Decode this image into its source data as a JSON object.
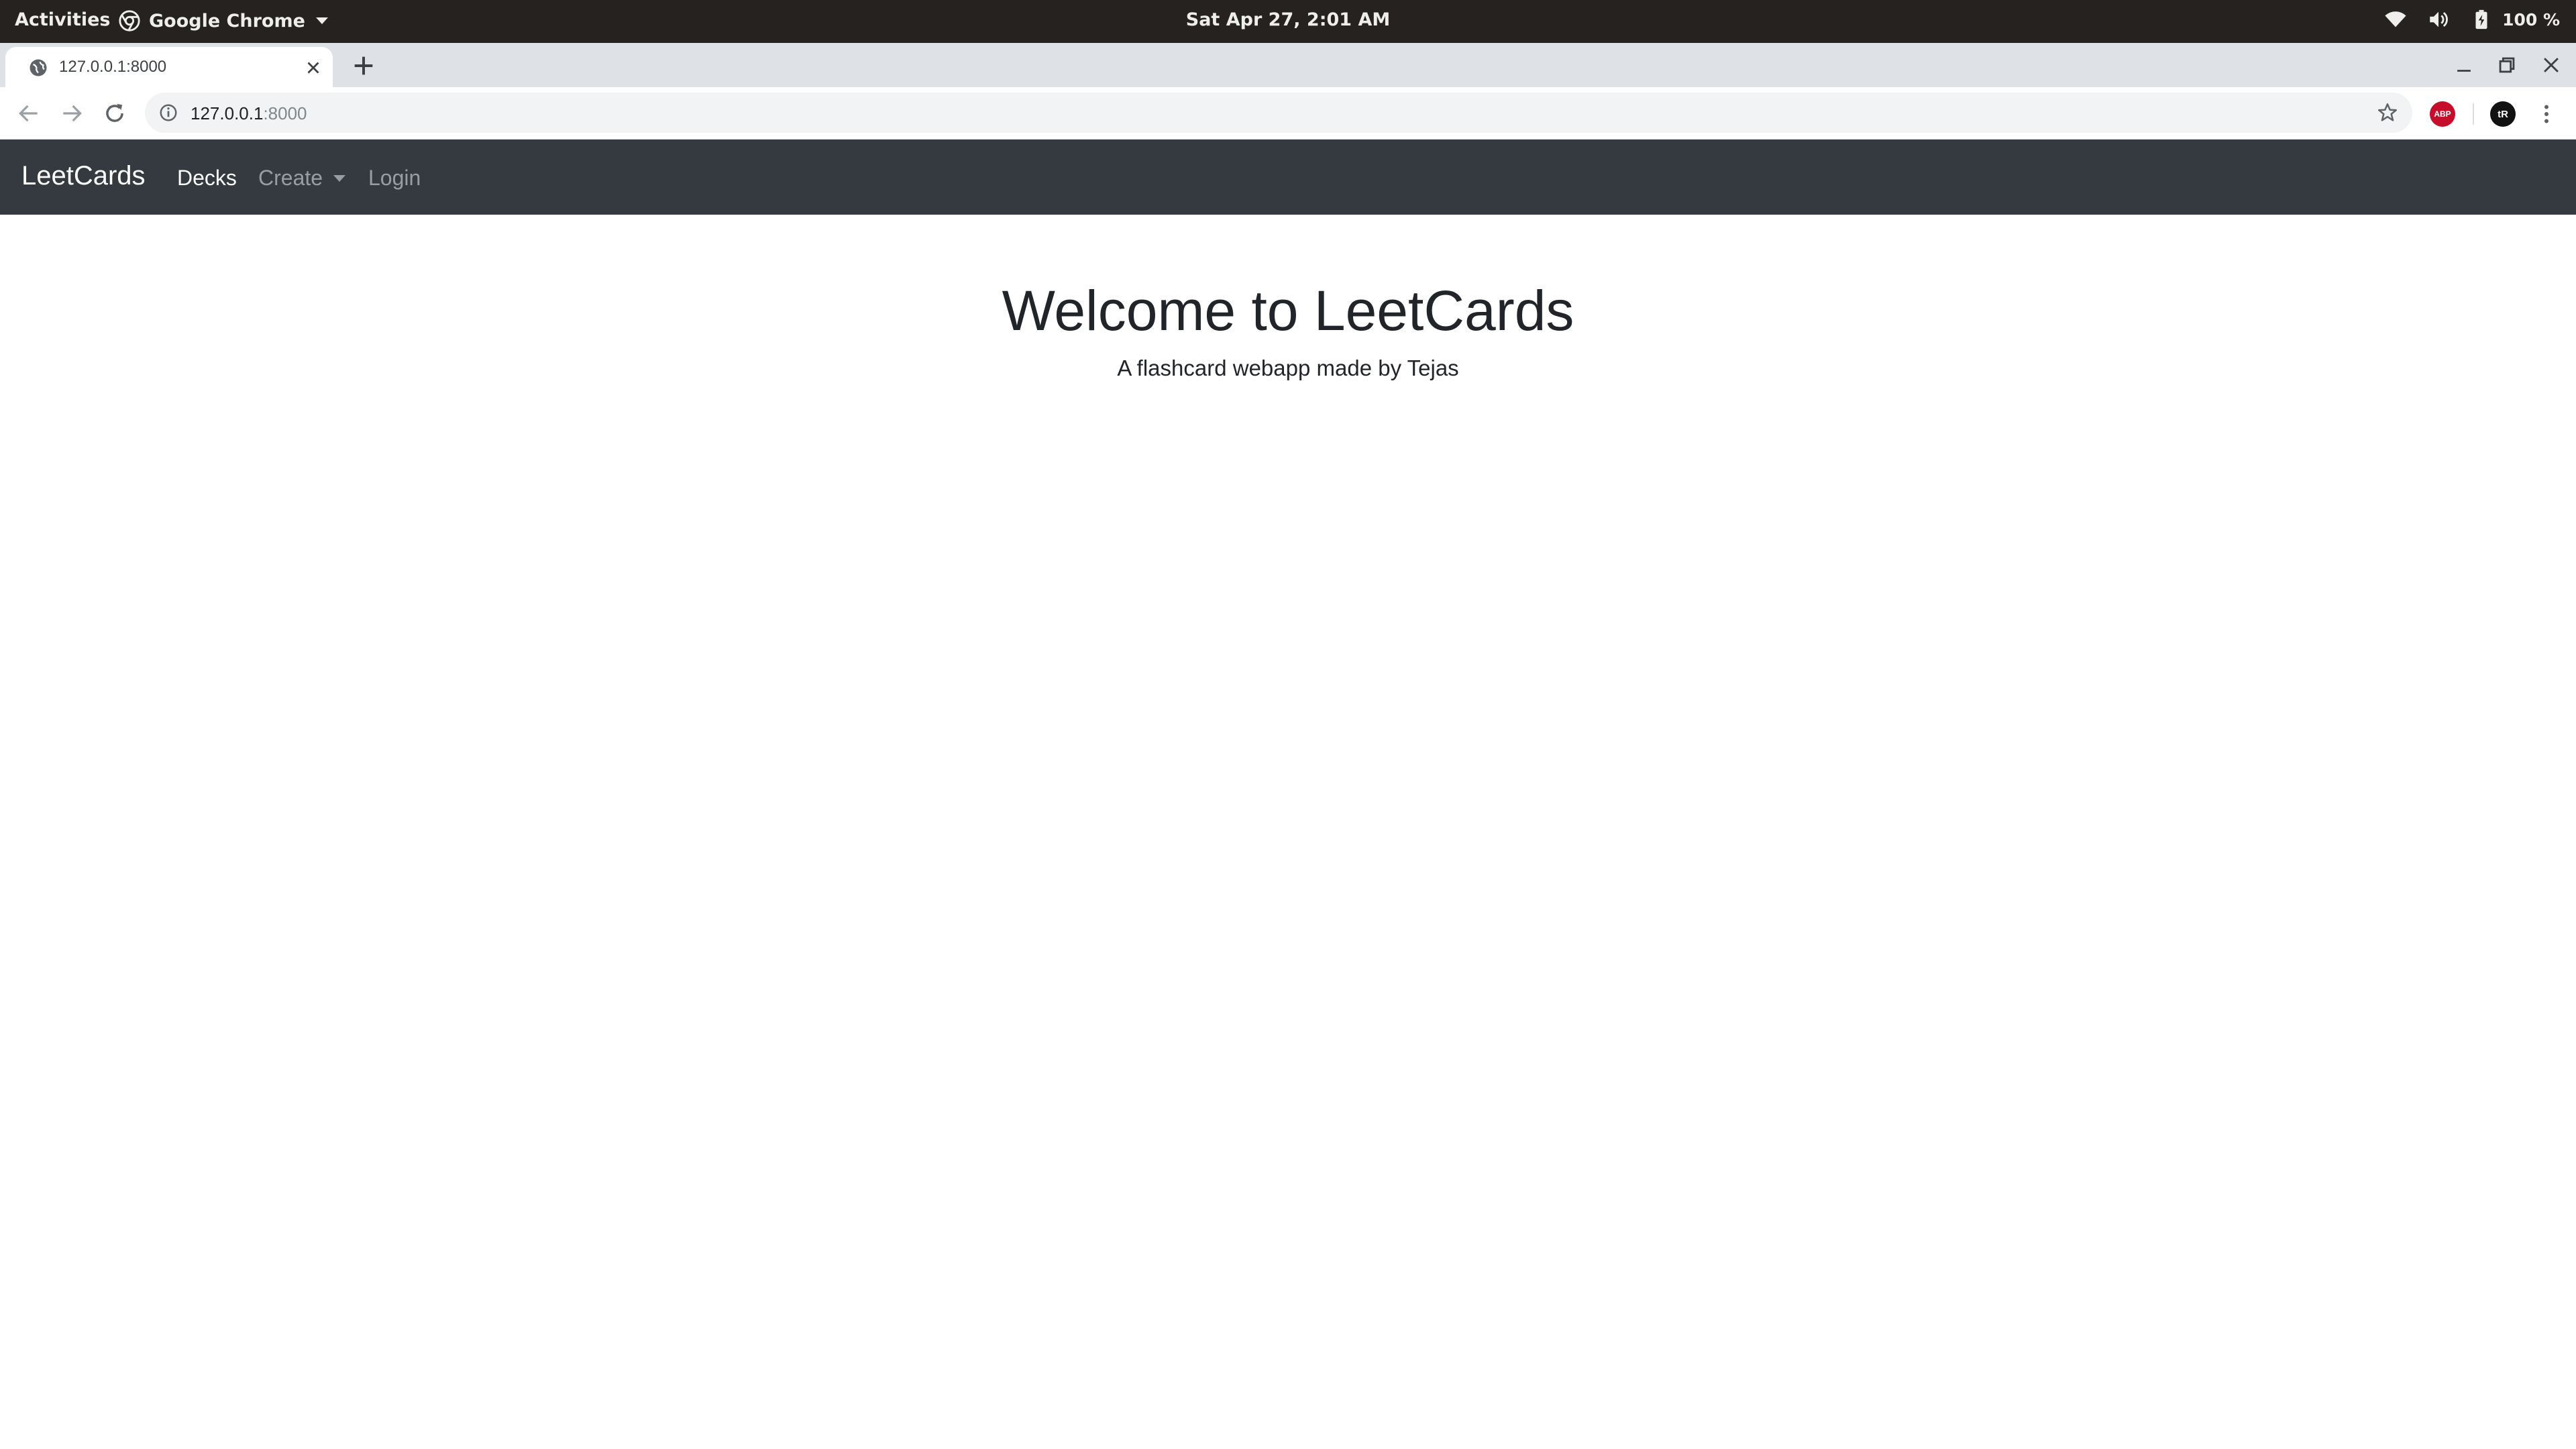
{
  "topbar": {
    "activities": "Activities",
    "app_name": "Google Chrome",
    "clock": "Sat Apr 27,  2:01 AM",
    "battery": "100 %"
  },
  "browser": {
    "tab_title": "127.0.0.1:8000",
    "url_host": "127.0.0.1",
    "url_port": ":8000",
    "extensions": {
      "abp_label": "ABP",
      "tr_label": "tR"
    }
  },
  "site": {
    "brand": "LeetCards",
    "nav": {
      "decks": "Decks",
      "create": "Create",
      "login": "Login"
    },
    "heading": "Welcome to LeetCards",
    "subheading": "A flashcard webapp made by Tejas"
  },
  "colors": {
    "navbar_bg": "#343a40",
    "system_bar_bg": "#252220",
    "tabstrip_bg": "#dee1e6",
    "omnibox_bg": "#f1f3f4",
    "abp_red": "#c70d2c"
  }
}
